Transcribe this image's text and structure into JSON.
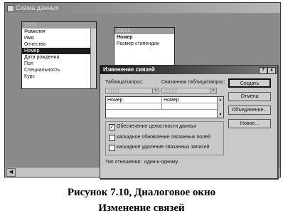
{
  "main_window": {
    "title": "Схема данных"
  },
  "table_1": {
    "name": "11111",
    "fields": [
      "Фамилия",
      "Имя",
      "Отчество",
      "Номер",
      "Дата рождения",
      "Пол",
      "Специальность",
      "Курс"
    ],
    "selected_field": "Номер"
  },
  "table_2": {
    "name": "22222",
    "fields": [
      "Номер",
      "Размер стипендии"
    ],
    "bold_field": "Номер"
  },
  "dialog": {
    "title": "Изменение связей",
    "help_button": "?",
    "close_button": "x",
    "table_label": "Таблица/запрос:",
    "related_label": "Связанная таблица/запрос:",
    "table_value": "11111",
    "related_value": "22222",
    "row1_left": "Номер",
    "row1_right": "Номер",
    "enforce_integrity": {
      "label": "Обеспечение целостности данных",
      "checked": true
    },
    "cascade_update": {
      "label": "каскадное обновление связанных полей",
      "checked": false
    },
    "cascade_delete": {
      "label": "каскадное удаление связанных записей",
      "checked": false
    },
    "relation_type_label": "Тип отношения:",
    "relation_type_value": "один-к-одному",
    "buttons": {
      "create": "Создать",
      "cancel": "Отмена",
      "join": "Объединение...",
      "new": "Новое..."
    }
  },
  "caption": {
    "line1": "Рисунок 7.10, Диалоговое окно",
    "line2": "Изменение связей"
  }
}
